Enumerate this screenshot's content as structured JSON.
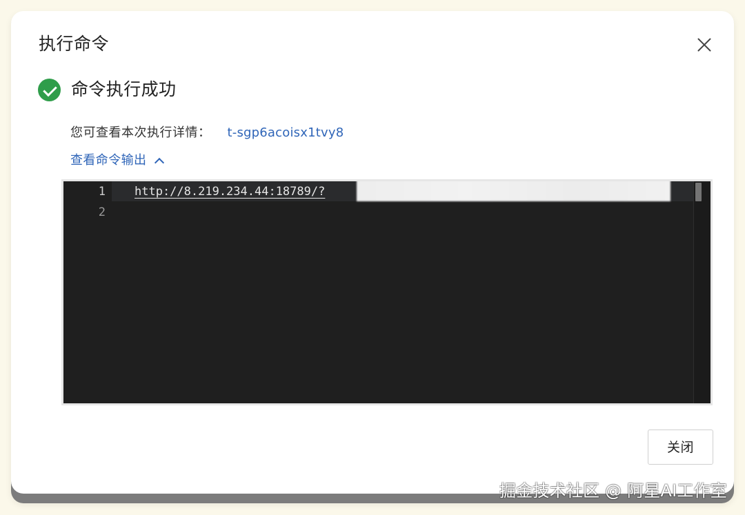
{
  "dialog": {
    "title": "执行命令",
    "status": {
      "text": "命令执行成功",
      "icon": "check-circle-icon",
      "color": "#2f9d4a"
    },
    "detail": {
      "label": "您可查看本次执行详情：",
      "task_id": "t-sgp6acoisx1tvy8"
    },
    "output_toggle": {
      "label": "查看命令输出",
      "icon": "chevron-up-icon"
    },
    "editor": {
      "lines": [
        {
          "number": "1",
          "text": "http://8.219.234.44:18789/?"
        },
        {
          "number": "2",
          "text": ""
        }
      ]
    },
    "footer": {
      "close_label": "关闭"
    }
  },
  "watermark": {
    "text": "掘金技术社区 @ 阿星AI工作室"
  },
  "colors": {
    "accent": "#2f65b8",
    "success": "#2f9d4a",
    "editor_background": "#1f1f1f"
  }
}
